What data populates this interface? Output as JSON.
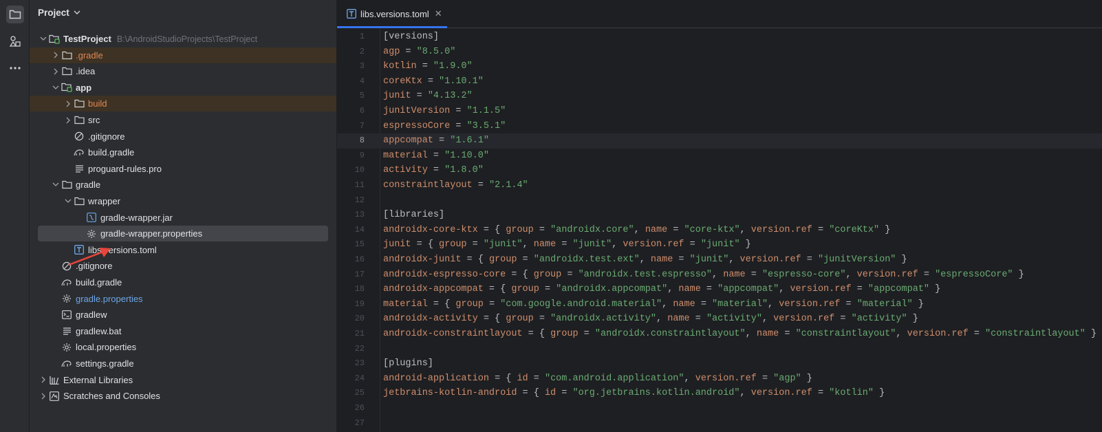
{
  "project_panel": {
    "title": "Project",
    "tree": [
      {
        "label": "TestProject",
        "path": "B:\\AndroidStudioProjects\\TestProject",
        "depth": 0,
        "expanded": true,
        "icon": "module-folder-icon",
        "bold": true
      },
      {
        "label": ".gradle",
        "depth": 1,
        "expanded": false,
        "icon": "folder-icon",
        "style": "excluded"
      },
      {
        "label": ".idea",
        "depth": 1,
        "expanded": false,
        "icon": "folder-icon"
      },
      {
        "label": "app",
        "depth": 1,
        "expanded": true,
        "icon": "module-folder-icon",
        "bold": true
      },
      {
        "label": "build",
        "depth": 2,
        "expanded": false,
        "icon": "folder-icon",
        "style": "excluded"
      },
      {
        "label": "src",
        "depth": 2,
        "expanded": false,
        "icon": "folder-icon"
      },
      {
        "label": ".gitignore",
        "depth": 2,
        "icon": "gitignore-icon"
      },
      {
        "label": "build.gradle",
        "depth": 2,
        "icon": "gradle-icon"
      },
      {
        "label": "proguard-rules.pro",
        "depth": 2,
        "icon": "text-file-icon"
      },
      {
        "label": "gradle",
        "depth": 1,
        "expanded": true,
        "icon": "folder-icon"
      },
      {
        "label": "wrapper",
        "depth": 2,
        "expanded": true,
        "icon": "folder-icon"
      },
      {
        "label": "gradle-wrapper.jar",
        "depth": 3,
        "icon": "jar-icon"
      },
      {
        "label": "gradle-wrapper.properties",
        "depth": 3,
        "icon": "settings-gear-icon",
        "style": "selected"
      },
      {
        "label": "libs.versions.toml",
        "depth": 2,
        "icon": "toml-icon"
      },
      {
        "label": ".gitignore",
        "depth": 1,
        "icon": "gitignore-icon"
      },
      {
        "label": "build.gradle",
        "depth": 1,
        "icon": "gradle-icon"
      },
      {
        "label": "gradle.properties",
        "depth": 1,
        "icon": "settings-gear-icon",
        "style": "blue"
      },
      {
        "label": "gradlew",
        "depth": 1,
        "icon": "terminal-icon"
      },
      {
        "label": "gradlew.bat",
        "depth": 1,
        "icon": "text-file-icon"
      },
      {
        "label": "local.properties",
        "depth": 1,
        "icon": "settings-gear-icon"
      },
      {
        "label": "settings.gradle",
        "depth": 1,
        "icon": "gradle-icon"
      },
      {
        "label": "External Libraries",
        "depth": 0,
        "expanded": false,
        "icon": "library-icon"
      },
      {
        "label": "Scratches and Consoles",
        "depth": 0,
        "expanded": false,
        "icon": "scratches-icon"
      }
    ]
  },
  "editor": {
    "tab": {
      "label": "libs.versions.toml",
      "icon": "toml-icon",
      "close": "✕"
    },
    "current_line": 8,
    "lines": [
      "[versions]",
      "agp = \"8.5.0\"",
      "kotlin = \"1.9.0\"",
      "coreKtx = \"1.10.1\"",
      "junit = \"4.13.2\"",
      "junitVersion = \"1.1.5\"",
      "espressoCore = \"3.5.1\"",
      "appcompat = \"1.6.1\"",
      "material = \"1.10.0\"",
      "activity = \"1.8.0\"",
      "constraintlayout = \"2.1.4\"",
      "",
      "[libraries]",
      "androidx-core-ktx = { group = \"androidx.core\", name = \"core-ktx\", version.ref = \"coreKtx\" }",
      "junit = { group = \"junit\", name = \"junit\", version.ref = \"junit\" }",
      "androidx-junit = { group = \"androidx.test.ext\", name = \"junit\", version.ref = \"junitVersion\" }",
      "androidx-espresso-core = { group = \"androidx.test.espresso\", name = \"espresso-core\", version.ref = \"espressoCore\" }",
      "androidx-appcompat = { group = \"androidx.appcompat\", name = \"appcompat\", version.ref = \"appcompat\" }",
      "material = { group = \"com.google.android.material\", name = \"material\", version.ref = \"material\" }",
      "androidx-activity = { group = \"androidx.activity\", name = \"activity\", version.ref = \"activity\" }",
      "androidx-constraintlayout = { group = \"androidx.constraintlayout\", name = \"constraintlayout\", version.ref = \"constraintlayout\" }",
      "",
      "[plugins]",
      "android-application = { id = \"com.android.application\", version.ref = \"agp\" }",
      "jetbrains-kotlin-android = { id = \"org.jetbrains.kotlin.android\", version.ref = \"kotlin\" }",
      "",
      ""
    ]
  },
  "colors": {
    "accent": "#3574f0",
    "annotation_arrow": "#e8453c"
  }
}
